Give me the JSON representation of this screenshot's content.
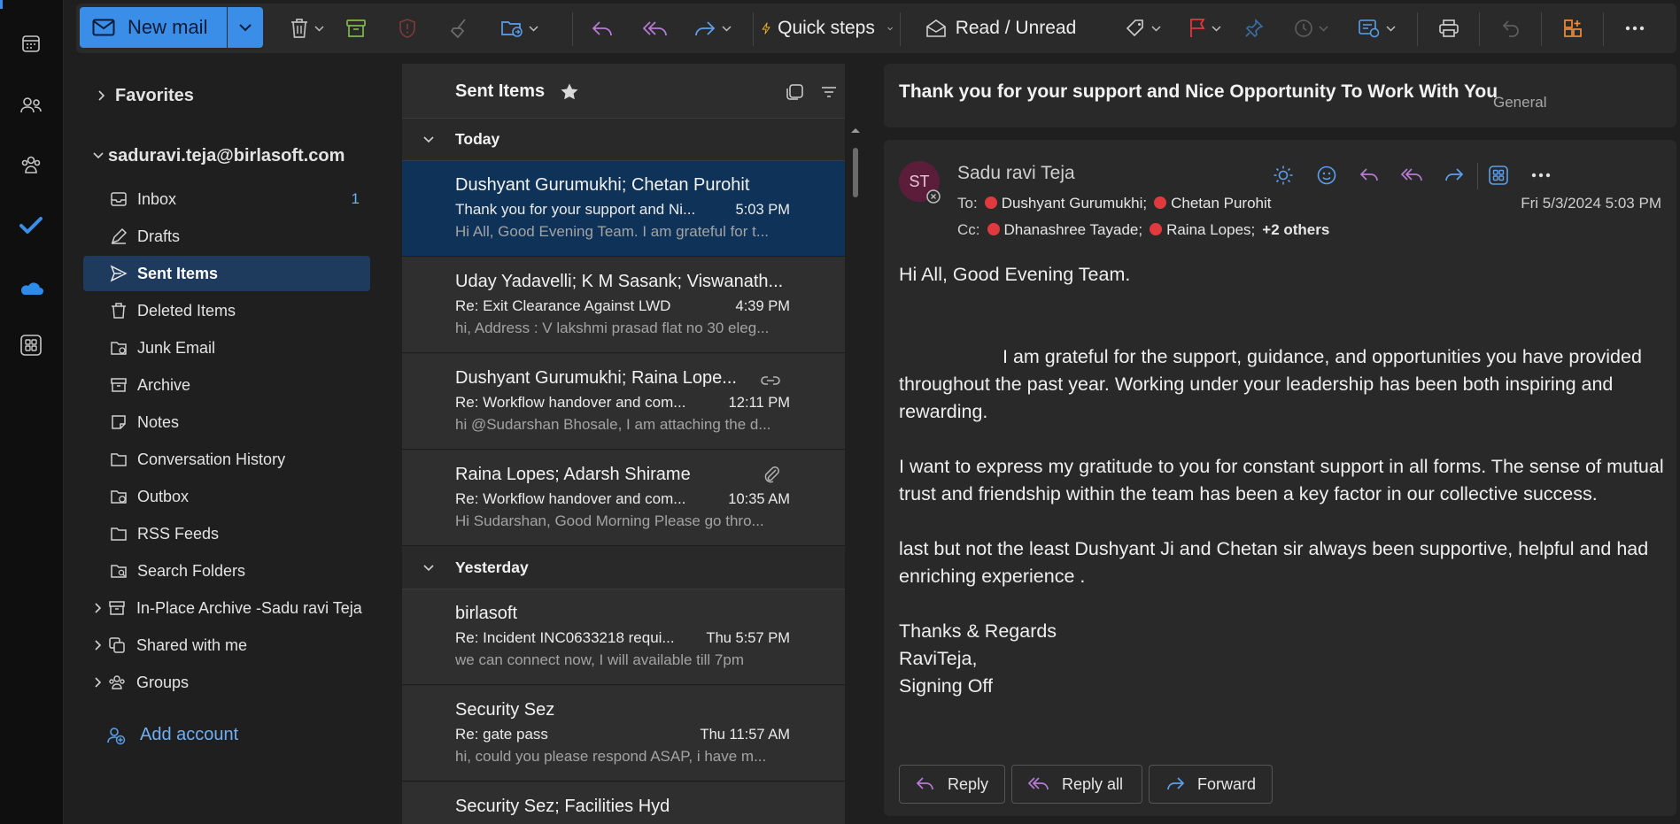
{
  "toolbar": {
    "new_mail_label": "New mail",
    "quick_steps_label": "Quick steps",
    "read_unread_label": "Read / Unread"
  },
  "folders": {
    "favorites_label": "Favorites",
    "account_label": "saduravi.teja@birlasoft.com",
    "items": [
      {
        "label": "Inbox",
        "count": "1",
        "icon": "inbox-icon"
      },
      {
        "label": "Drafts",
        "icon": "drafts-icon"
      },
      {
        "label": "Sent Items",
        "icon": "send-icon"
      },
      {
        "label": "Deleted Items",
        "icon": "trash-icon"
      },
      {
        "label": "Junk Email",
        "icon": "junk-folder-icon"
      },
      {
        "label": "Archive",
        "icon": "archive-icon"
      },
      {
        "label": "Notes",
        "icon": "notes-icon"
      },
      {
        "label": "Conversation History",
        "icon": "folder-icon"
      },
      {
        "label": "Outbox",
        "icon": "outbox-icon"
      },
      {
        "label": "RSS Feeds",
        "icon": "folder-icon"
      },
      {
        "label": "Search Folders",
        "icon": "search-folder-icon"
      }
    ],
    "in_place_archive_label": "In-Place Archive -Sadu ravi Teja",
    "shared_label": "Shared with me",
    "groups_label": "Groups",
    "add_account_label": "Add account"
  },
  "list": {
    "title": "Sent Items",
    "today_label": "Today",
    "yesterday_label": "Yesterday",
    "messages": [
      {
        "sender": "Dushyant Gurumukhi; Chetan Purohit",
        "subject": "Thank you for your support and Ni...",
        "time": "5:03 PM",
        "preview": "Hi All, Good Evening Team. I am grateful for t..."
      },
      {
        "sender": "Uday Yadavelli; K M Sasank; Viswanath...",
        "subject": "Re: Exit Clearance Against LWD",
        "time": "4:39 PM",
        "preview": "hi, Address : V lakshmi prasad flat no 30 eleg..."
      },
      {
        "sender": "Dushyant Gurumukhi; Raina Lope...",
        "subject": "Re: Workflow handover and com...",
        "time": "12:11 PM",
        "preview": "hi @Sudarshan Bhosale, I am attaching the d..."
      },
      {
        "sender": "Raina Lopes; Adarsh Shirame",
        "subject": "Re: Workflow handover and com...",
        "time": "10:35 AM",
        "preview": "Hi Sudarshan, Good Morning Please go thro..."
      },
      {
        "sender": "birlasoft",
        "subject": "Re: Incident INC0633218 requi...",
        "time": "Thu 5:57 PM",
        "preview": "we can connect now, I will available till 7pm"
      },
      {
        "sender": "Security Sez",
        "subject": "Re: gate pass",
        "time": "Thu 11:57 AM",
        "preview": "hi, could you please respond ASAP, i have m..."
      },
      {
        "sender": "Security Sez; Facilities Hyd",
        "subject": "",
        "time": "",
        "preview": ""
      }
    ]
  },
  "reading": {
    "subject": "Thank you for your support and Nice Opportunity To Work With You",
    "category": "General",
    "avatar_initials": "ST",
    "from_name": "Sadu ravi Teja",
    "to_label": "To:",
    "to": [
      "Dushyant Gurumukhi;",
      "Chetan Purohit"
    ],
    "cc_label": "Cc:",
    "cc": [
      "Dhanashree Tayade;",
      "Raina Lopes;"
    ],
    "cc_more": "+2 others",
    "date": "Fri 5/3/2024 5:03 PM",
    "body": {
      "greeting": "Hi All, Good Evening Team.",
      "p1": "I am grateful for the support, guidance, and opportunities you have provided throughout the past year. Working under your leadership has been both inspiring and rewarding.",
      "p2": "I want to express my gratitude to you  for constant support in all forms. The sense of mutual trust and friendship within the team has been a key factor in our collective success.",
      "p3": "last but not the least Dushyant Ji and Chetan sir  always been supportive, helpful and had  enriching experience .",
      "sign1": "Thanks & Regards",
      "sign2": "RaviTeja,",
      "sign3": "Signing Off"
    },
    "reply_label": "Reply",
    "reply_all_label": "Reply all",
    "forward_label": "Forward"
  },
  "colors": {
    "accent": "#3b8ee8",
    "selected_message": "#0f3358",
    "selected_folder": "#1e3a5c",
    "presence_busy": "#e0393e",
    "avatar_bg": "#5c1d3a"
  }
}
